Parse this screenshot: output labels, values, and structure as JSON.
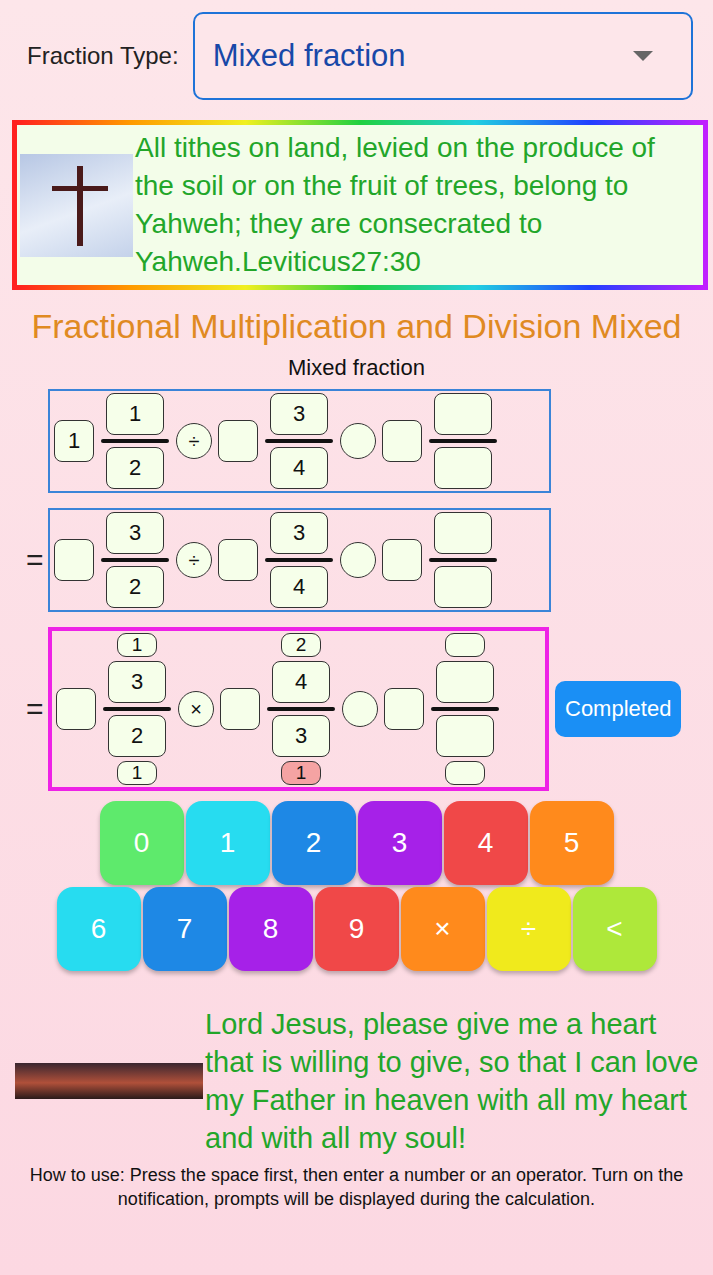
{
  "selector": {
    "label": "Fraction Type:",
    "value": "Mixed fraction"
  },
  "verse": "All tithes on land, levied on the produce of the soil or on the fruit of trees, belong to Yahweh; they are consecrated to Yahweh.Leviticus27:30",
  "title": "Fractional Multiplication and Division Mixed",
  "subtitle": "Mixed fraction",
  "rows": [
    {
      "kind": "plain",
      "prefix": "",
      "active": false,
      "terms": [
        {
          "whole": "1",
          "num": "1",
          "den": "2"
        },
        {
          "whole": "",
          "num": "3",
          "den": "4"
        },
        {
          "whole": "",
          "num": "",
          "den": ""
        }
      ],
      "ops": [
        "÷",
        ""
      ]
    },
    {
      "kind": "plain",
      "prefix": "=",
      "active": false,
      "terms": [
        {
          "whole": "",
          "num": "3",
          "den": "2"
        },
        {
          "whole": "",
          "num": "3",
          "den": "4"
        },
        {
          "whole": "",
          "num": "",
          "den": ""
        }
      ],
      "ops": [
        "÷",
        ""
      ]
    },
    {
      "kind": "reduce",
      "prefix": "=",
      "active": true,
      "button": "Completed",
      "terms": [
        {
          "whole": "",
          "top": "1",
          "num": "3",
          "den": "2",
          "bottom": "1",
          "bottom_selected": false
        },
        {
          "whole": "",
          "top": "2",
          "num": "4",
          "den": "3",
          "bottom": "1",
          "bottom_selected": true
        },
        {
          "whole": "",
          "top": "",
          "num": "",
          "den": "",
          "bottom": "",
          "bottom_selected": false
        }
      ],
      "ops": [
        "×",
        ""
      ]
    }
  ],
  "keypad": [
    [
      {
        "label": "0",
        "color": "#5eea6c"
      },
      {
        "label": "1",
        "color": "#27dcf0"
      },
      {
        "label": "2",
        "color": "#1e88e5"
      },
      {
        "label": "3",
        "color": "#a621e8"
      },
      {
        "label": "4",
        "color": "#f04848"
      },
      {
        "label": "5",
        "color": "#ff8a1c"
      }
    ],
    [
      {
        "label": "6",
        "color": "#27dcf0"
      },
      {
        "label": "7",
        "color": "#1e88e5"
      },
      {
        "label": "8",
        "color": "#a621e8"
      },
      {
        "label": "9",
        "color": "#f04848"
      },
      {
        "label": "×",
        "color": "#ff8a1c"
      },
      {
        "label": "÷",
        "color": "#f0ea1c"
      },
      {
        "label": "<",
        "color": "#aee83a"
      }
    ]
  ],
  "prayer": "Lord Jesus, please give me a heart that is willing to give, so that I can love my Father in heaven with all my heart and with all my soul!",
  "instructions": "How to use: Press the space first, then enter a number or an operator. Turn on the notification, prompts will be displayed during the calculation."
}
